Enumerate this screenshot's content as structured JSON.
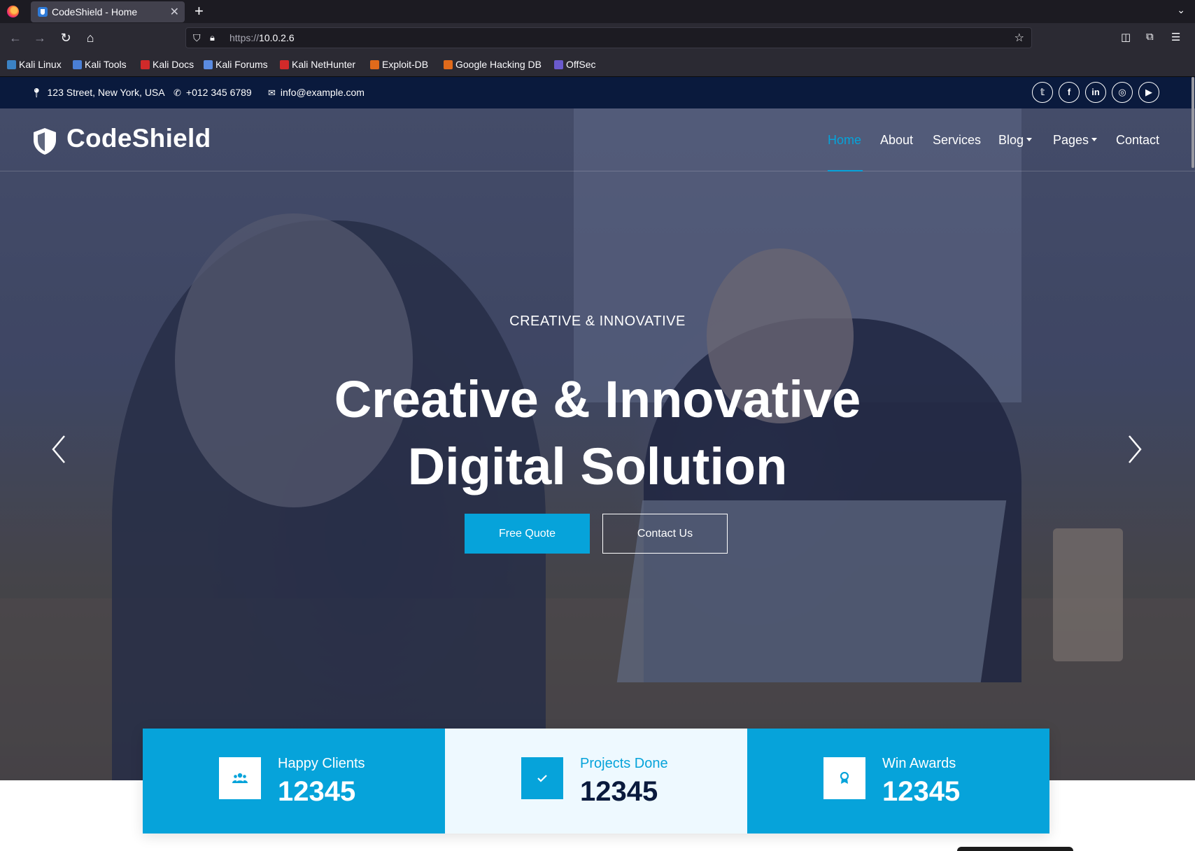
{
  "browser": {
    "tab_title": "CodeShield - Home",
    "url_prefix": "https://",
    "url_host": "10.0.2.6",
    "bookmarks": [
      {
        "label": "Kali Linux",
        "color": "#3b82c4"
      },
      {
        "label": "Kali Tools",
        "color": "#4a7fd6"
      },
      {
        "label": "Kali Docs",
        "color": "#d12a2a"
      },
      {
        "label": "Kali Forums",
        "color": "#5b8be0"
      },
      {
        "label": "Kali NetHunter",
        "color": "#d12a2a"
      },
      {
        "label": "Exploit-DB",
        "color": "#e06a1b"
      },
      {
        "label": "Google Hacking DB",
        "color": "#e06a1b"
      },
      {
        "label": "OffSec",
        "color": "#6a5acd"
      }
    ]
  },
  "topbar": {
    "address": "123 Street, New York, USA",
    "phone": "+012 345 6789",
    "email": "info@example.com",
    "social": [
      "twitter-icon",
      "facebook-icon",
      "linkedin-icon",
      "instagram-icon",
      "youtube-icon"
    ]
  },
  "header": {
    "logo": "CodeShield",
    "menu": [
      {
        "label": "Home",
        "active": true
      },
      {
        "label": "About"
      },
      {
        "label": "Services"
      },
      {
        "label": "Blog",
        "dropdown": true
      },
      {
        "label": "Pages",
        "dropdown": true
      },
      {
        "label": "Contact"
      }
    ]
  },
  "hero": {
    "subtitle": "CREATIVE & INNOVATIVE",
    "title_line1": "Creative & Innovative",
    "title_line2": "Digital Solution",
    "primary_button": "Free Quote",
    "secondary_button": "Contact Us"
  },
  "stats": [
    {
      "label": "Happy Clients",
      "value": "12345",
      "icon": "users-icon"
    },
    {
      "label": "Projects Done",
      "value": "12345",
      "icon": "check-icon"
    },
    {
      "label": "Win Awards",
      "value": "12345",
      "icon": "award-icon"
    }
  ],
  "colors": {
    "accent": "#06a3da",
    "dark": "#0a1a3d",
    "light": "#eef9ff"
  }
}
